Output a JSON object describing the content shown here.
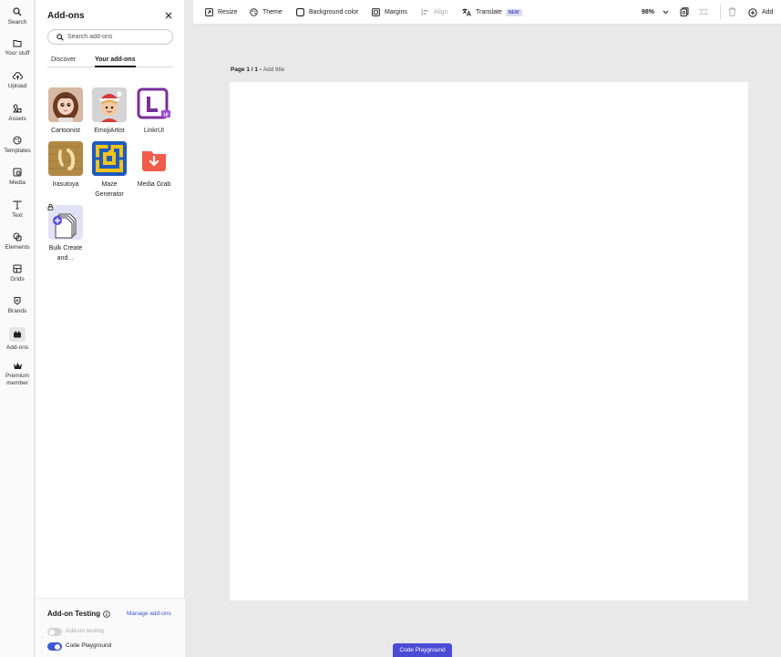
{
  "rail": {
    "items": [
      {
        "label": "Search",
        "icon": "search-icon"
      },
      {
        "label": "Your stuff",
        "icon": "folder-icon"
      },
      {
        "label": "Upload",
        "icon": "upload-icon"
      },
      {
        "label": "Assets",
        "icon": "assets-icon"
      },
      {
        "label": "Templates",
        "icon": "templates-icon"
      },
      {
        "label": "Media",
        "icon": "media-icon"
      },
      {
        "label": "Text",
        "icon": "text-icon"
      },
      {
        "label": "Elements",
        "icon": "elements-icon"
      },
      {
        "label": "Grids",
        "icon": "grids-icon"
      },
      {
        "label": "Brands",
        "icon": "brands-icon"
      },
      {
        "label": "Add-ons",
        "icon": "addons-icon"
      },
      {
        "label": "Premium",
        "label2": "member",
        "icon": "crown-icon"
      }
    ],
    "active": "Add-ons"
  },
  "panel": {
    "title": "Add-ons",
    "search_placeholder": "Search add-ons",
    "tabs": [
      {
        "label": "Discover",
        "active": false
      },
      {
        "label": "Your add-ons",
        "active": true
      }
    ],
    "addons": [
      {
        "label": "Cartoonist"
      },
      {
        "label": "EmojiArtist"
      },
      {
        "label": "LinkrUI"
      },
      {
        "label": "Irasutoya"
      },
      {
        "label": "Maze",
        "label2": "Generator"
      },
      {
        "label": "Media Grab"
      },
      {
        "label": "Bulk Create",
        "label2": "and…",
        "locked": true
      }
    ],
    "footer": {
      "title": "Add-on Testing",
      "manage": "Manage add-ons",
      "testing_label": "Add-on testing",
      "testing_on": false,
      "playground_label": "Code Playground",
      "playground_on": true
    }
  },
  "toolbar": {
    "resize": "Resize",
    "theme": "Theme",
    "background": "Background color",
    "margins": "Margins",
    "align": "Align",
    "translate": "Translate",
    "new_badge": "NEW",
    "zoom": "98%",
    "add": "Add"
  },
  "canvas": {
    "page_label": "Page 1 / 1",
    "separator": " - ",
    "add_title": "Add title"
  },
  "playground_button": "Code Playground",
  "colors": {
    "accent": "#4b4bd6",
    "link": "#3b57d9"
  }
}
